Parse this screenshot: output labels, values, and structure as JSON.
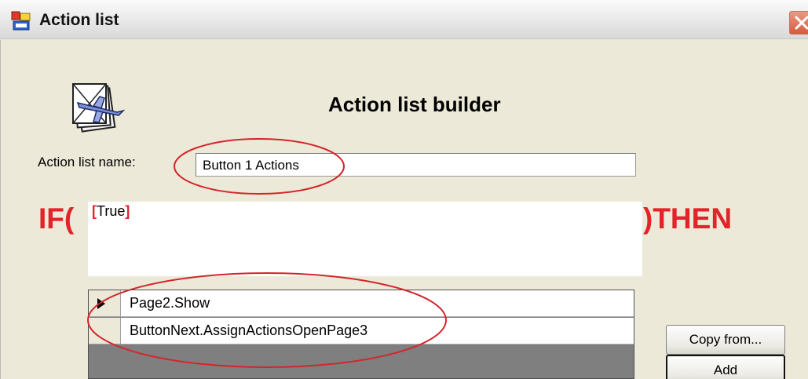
{
  "window": {
    "title": "Action list",
    "accent": "#e32229"
  },
  "icons": {
    "title_icon": "app-window-icon",
    "close_icon": "close-icon",
    "builder_icon": "airplane-document-icon",
    "row_pointer": "current-row-arrow-icon"
  },
  "header": {
    "heading": "Action list builder"
  },
  "form": {
    "name_label": "Action list name:",
    "name_value": "Button 1 Actions"
  },
  "condition": {
    "if_label": "IF(",
    "then_label": ")THEN",
    "open_bracket": "[",
    "value": "True",
    "close_bracket": "]"
  },
  "actions": {
    "rows": [
      {
        "action": "Page2.Show"
      },
      {
        "action": "ButtonNext.AssignActionsOpenPage3"
      }
    ]
  },
  "buttons": {
    "copy_from": "Copy from...",
    "add": "Add"
  }
}
